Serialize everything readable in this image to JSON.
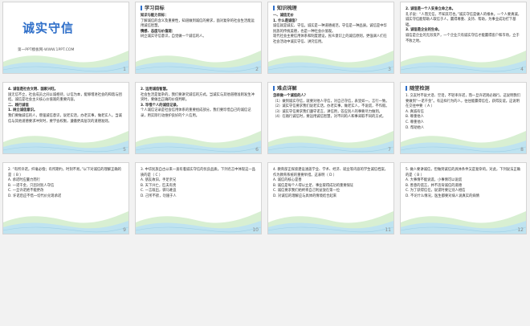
{
  "slides": [
    {
      "id": 1,
      "type": "cover",
      "title": "诚实守信",
      "subtitle": "第一PPT模板网-WWW.1PPT.COM",
      "number": "1"
    },
    {
      "id": 2,
      "type": "goals",
      "header": "学习目标",
      "lines": [
        {
          "text": "知识与能力目标：",
          "style": "b"
        },
        {
          "text": "了解诚信的含义及重要性，知道做到诚信的要求，面对复杂的社会生活能运用诚信智慧。",
          "style": ""
        },
        {
          "text": "情感、态度与价值观：",
          "style": "b"
        },
        {
          "text": "树立诚实守信意识，自觉做一个诚信的人。",
          "style": ""
        }
      ],
      "number": "2"
    },
    {
      "id": 3,
      "type": "content",
      "header": "知识梳理",
      "lines": [
        {
          "text": "一、诚信无价",
          "style": "b"
        },
        {
          "text": "1. 什么是诚信？",
          "style": "b"
        },
        {
          "text": "诚信就是诚实、守信。诚实是一种道德规范，守信是一种品质。诚信是中华民族的传统美德，也是一种社会价值观。",
          "style": ""
        },
        {
          "text": "现代社会主要信用体系和制度建设，民众意识上的诚信原则，更强调人们在社会活动中诚实守信、讲究信用。",
          "style": ""
        }
      ],
      "number": "3"
    },
    {
      "id": 4,
      "type": "content",
      "header": "",
      "lines": [
        {
          "text": "2. 诚信是一个人安身立命之本。",
          "style": "b"
        },
        {
          "text": "孔子说：“人而无信，不知其可也。”诚实守信是做人的根本。一个人要真诚，诚实守信能帮助人取信于人，赢得尊重、支持、帮助，为事业成功打下基础。",
          "style": ""
        },
        {
          "text": "3. 诚信是企业的生命。",
          "style": "b"
        },
        {
          "text": "诚信是企业的无形资产，一个企业只有诚实守信才能赢得客户和市场，立于不败之地。",
          "style": ""
        }
      ],
      "number": "4"
    },
    {
      "id": 5,
      "type": "content",
      "header": "",
      "lines": [
        {
          "text": "4. 诚信是社会文明、国家兴旺。",
          "style": "b"
        },
        {
          "text": "国无信不立，社会成员之间以诚相待，以信为本，能够增进社会的和谐与团结。诚信是社会主义核心价值观的重要内容。",
          "style": ""
        },
        {
          "text": "二、践行诚信",
          "style": "b"
        },
        {
          "text": "1. 树立诚信意识。",
          "style": "b"
        },
        {
          "text": "我们要做诚信的人，增强诚信意识，说老实话，办老实事，做老实人。当诚信与其他道德要求冲突时，要学会权衡，遵循更高层次的道德准则。",
          "style": ""
        }
      ],
      "number": "5"
    },
    {
      "id": 6,
      "type": "content",
      "header": "",
      "lines": [
        {
          "text": "2. 运用诚信智慧。",
          "style": "b"
        },
        {
          "text": "社会生活是复杂的，我们要讲究诚信的方式。当诚实与其他道德准则发生冲突时，要做出正确的价值判断。",
          "style": ""
        },
        {
          "text": "3. 珍惜个人的诚信记录。",
          "style": "b"
        },
        {
          "text": "个人诚信记录是社会信用体系的重要组成部分。我们要珍惜自己的诚信记录，用实际行动维护良好的个人信用。",
          "style": ""
        }
      ],
      "number": "6"
    },
    {
      "id": 7,
      "type": "content",
      "header": "难点详解",
      "lines": [
        {
          "text": "怎样做一个诚信的人？",
          "style": "b"
        },
        {
          "text": "（1）做到诚实守信，就要对他人守信，对自己守信，表里如一，言行一致。",
          "style": ""
        },
        {
          "text": "（2）诚实守信要求我们说老实话，办老实事，做老实人，不说谎，不作假。",
          "style": ""
        },
        {
          "text": "（3）诚实守信要求我们遵守诺言，讲信用，答应别人的事要尽力做到。",
          "style": ""
        },
        {
          "text": "（4）在践行诚信时，要运用诚信智慧，对不同的人和事采取不同的方式。",
          "style": ""
        }
      ],
      "number": "7"
    },
    {
      "id": 8,
      "type": "question",
      "header": "随堂检测",
      "stem": "1. 交友时不说大话、空话，不轻率许诺，而一旦许诺则必践行。这说明我们要做到“一诺千金”。有这样行为的人，往往能赢得信任，获得友谊。这说明在交往中要（ A ）",
      "options": [
        "A. 真诚有信",
        "B. 尊重他人",
        "C. 尊重他人",
        "D. 帮助他人"
      ],
      "number": "8"
    },
    {
      "id": 9,
      "type": "question",
      "header": "",
      "stem": "2. “有所许诺，纤毫必偿；有所期约，时刻不易。”以下对诚信的理解正确的是（ B ）",
      "options": [
        "A. 承诺时应量力而行",
        "B. 一诺千金，只因对别人守信",
        "C. 一旦许诺绝不能更改",
        "D. 许诺后应不惜一切代价兑现承诺"
      ],
      "number": "9"
    },
    {
      "id": 10,
      "type": "question",
      "header": "",
      "stem": "3. 中华民族自古以来一直有着诚实守信的优良品质。下列名言中体现这一品质的是（ C ）",
      "options": [
        "A. 朋友故旧，手足亲兄",
        "B. 天下兴亡，匹夫有责",
        "C. 一言既出，驷马难追",
        "D. 己所不欲，勿施于人"
      ],
      "number": "10"
    },
    {
      "id": 11,
      "type": "question",
      "header": "",
      "stem": "4. 教育部正探索建设涵盖学业、学术、经济、就业等内容的学生诚信档案，作为教育系统的重要举措。这表明（ D ）",
      "options": [
        "A. 诚信的核心是善",
        "B. 诚信是每个人得以立足、事业取得成功的重要保证",
        "C. 诚信要求我们始终将自己利益放在第一位",
        "D. 对诚信的理解应与具体的情境结合起来"
      ],
      "number": "11"
    },
    {
      "id": 12,
      "type": "question",
      "header": "",
      "stem": "5. 做人要讲诚信，但做到诚信的具体条件又是复杂的。对此，下列说法正确的是（ B ）",
      "options": [
        "A. 大事情不能说谎，小事情可以说谎",
        "B. 善意的谎言，并不违背诚信的道德",
        "C. 为了获得信任，说谎时要让别人相信",
        "D. 不论什么情况，医生都要对病人说真实的病情"
      ],
      "number": "12"
    }
  ],
  "colors": {
    "accent": "#2f6fc9",
    "red": "#d11a1a",
    "wave1": "#bfe3f0",
    "wave2": "#d8efd2"
  }
}
